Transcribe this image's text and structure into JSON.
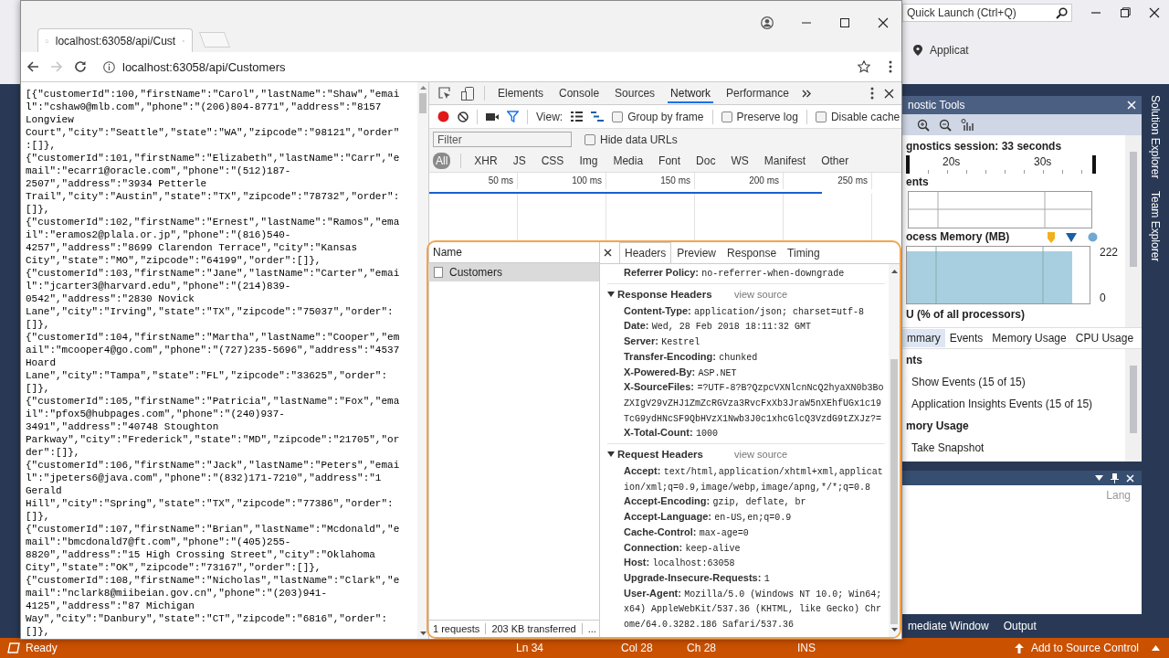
{
  "chrome": {
    "tab": {
      "title": "localhost:63058/api/Cust"
    },
    "forward_disabled": true,
    "address": "localhost:63058/api/Customers"
  },
  "json_view": {
    "records": [
      "[{\"customerId\":100,\"firstName\":\"Carol\",\"lastName\":\"Shaw\",\"email\":\"cshaw0@mlb.com\",\"phone\":\"(206)804-8771\",\"address\":\"8157 Longview Court\",\"city\":\"Seattle\",\"state\":\"WA\",\"zipcode\":\"98121\",\"order\":[]},",
      "{\"customerId\":101,\"firstName\":\"Elizabeth\",\"lastName\":\"Carr\",\"email\":\"ecarr1@oracle.com\",\"phone\":\"(512)187-2507\",\"address\":\"3934 Petterle Trail\",\"city\":\"Austin\",\"state\":\"TX\",\"zipcode\":\"78732\",\"order\":[]},",
      "{\"customerId\":102,\"firstName\":\"Ernest\",\"lastName\":\"Ramos\",\"email\":\"eramos2@plala.or.jp\",\"phone\":\"(816)540-4257\",\"address\":\"8699 Clarendon Terrace\",\"city\":\"Kansas City\",\"state\":\"MO\",\"zipcode\":\"64199\",\"order\":[]},",
      "{\"customerId\":103,\"firstName\":\"Jane\",\"lastName\":\"Carter\",\"email\":\"jcarter3@harvard.edu\",\"phone\":\"(214)839-0542\",\"address\":\"2830 Novick Lane\",\"city\":\"Irving\",\"state\":\"TX\",\"zipcode\":\"75037\",\"order\":[]},",
      "{\"customerId\":104,\"firstName\":\"Martha\",\"lastName\":\"Cooper\",\"email\":\"mcooper4@go.com\",\"phone\":\"(727)235-5696\",\"address\":\"4537 Hoard Lane\",\"city\":\"Tampa\",\"state\":\"FL\",\"zipcode\":\"33625\",\"order\":[]},",
      "{\"customerId\":105,\"firstName\":\"Patricia\",\"lastName\":\"Fox\",\"email\":\"pfox5@hubpages.com\",\"phone\":\"(240)937-3491\",\"address\":\"40748 Stoughton Parkway\",\"city\":\"Frederick\",\"state\":\"MD\",\"zipcode\":\"21705\",\"order\":[]},",
      "{\"customerId\":106,\"firstName\":\"Jack\",\"lastName\":\"Peters\",\"email\":\"jpeters6@java.com\",\"phone\":\"(832)171-7210\",\"address\":\"1 Gerald Hill\",\"city\":\"Spring\",\"state\":\"TX\",\"zipcode\":\"77386\",\"order\":[]},",
      "{\"customerId\":107,\"firstName\":\"Brian\",\"lastName\":\"Mcdonald\",\"email\":\"bmcdonald7@ft.com\",\"phone\":\"(405)255-8820\",\"address\":\"15 High Crossing Street\",\"city\":\"Oklahoma City\",\"state\":\"OK\",\"zipcode\":\"73167\",\"order\":[]},",
      "{\"customerId\":108,\"firstName\":\"Nicholas\",\"lastName\":\"Clark\",\"email\":\"nclark8@miibeian.gov.cn\",\"phone\":\"(203)941-4125\",\"address\":\"87 Michigan Way\",\"city\":\"Danbury\",\"state\":\"CT\",\"zipcode\":\"6816\",\"order\":[]},"
    ]
  },
  "devtools": {
    "tabs": [
      {
        "label": "Elements",
        "selected": false
      },
      {
        "label": "Console",
        "selected": false
      },
      {
        "label": "Sources",
        "selected": false
      },
      {
        "label": "Network",
        "selected": true
      },
      {
        "label": "Performance",
        "selected": false
      }
    ],
    "toolbar": {
      "view_label": "View:",
      "options": [
        {
          "label": "Group by frame",
          "checked": false
        },
        {
          "label": "Preserve log",
          "checked": false
        },
        {
          "label": "Disable cache",
          "checked": false
        }
      ]
    },
    "filter": {
      "placeholder": "Filter",
      "option": {
        "label": "Hide data URLs",
        "checked": false
      }
    },
    "types": [
      {
        "label": "All",
        "selected": true
      },
      {
        "label": "XHR",
        "selected": false
      },
      {
        "label": "JS",
        "selected": false
      },
      {
        "label": "CSS",
        "selected": false
      },
      {
        "label": "Img",
        "selected": false
      },
      {
        "label": "Media",
        "selected": false
      },
      {
        "label": "Font",
        "selected": false
      },
      {
        "label": "Doc",
        "selected": false
      },
      {
        "label": "WS",
        "selected": false
      },
      {
        "label": "Manifest",
        "selected": false
      },
      {
        "label": "Other",
        "selected": false
      }
    ],
    "overview_ticks": [
      "50 ms",
      "100 ms",
      "150 ms",
      "200 ms",
      "250 ms"
    ],
    "requests": {
      "column": "Name",
      "rows": [
        {
          "name": "Customers",
          "selected": true
        }
      ],
      "summary": [
        "1 requests",
        "203 KB transferred",
        "..."
      ]
    },
    "details": {
      "tabs": [
        {
          "label": "Headers",
          "selected": true
        },
        {
          "label": "Preview",
          "selected": false
        },
        {
          "label": "Response",
          "selected": false
        },
        {
          "label": "Timing",
          "selected": false
        }
      ],
      "general": [
        {
          "name": "Referrer Policy:",
          "value": "no-referrer-when-downgrade"
        }
      ],
      "sections": [
        {
          "title": "Response Headers",
          "link": "view source",
          "expanded": true,
          "headers": [
            {
              "name": "Content-Type:",
              "value": "application/json; charset=utf-8"
            },
            {
              "name": "Date:",
              "value": "Wed, 28 Feb 2018 18:11:32 GMT"
            },
            {
              "name": "Server:",
              "value": "Kestrel"
            },
            {
              "name": "Transfer-Encoding:",
              "value": "chunked"
            },
            {
              "name": "X-Powered-By:",
              "value": "ASP.NET"
            },
            {
              "name": "X-SourceFiles:",
              "value": "=?UTF-8?B?QzpcVXNlcnNcQ2hyaXN0b3BoZXIgV29vZHJ1ZmZcRGVza3RvcFxXb3JraW5nXEhfUGx1c19TcG9ydHNcSF9QbHVzX1Nwb3J0c1xhcGlcQ3VzdG9tZXJz?="
            },
            {
              "name": "X-Total-Count:",
              "value": "1000"
            }
          ]
        },
        {
          "title": "Request Headers",
          "link": "view source",
          "expanded": true,
          "headers": [
            {
              "name": "Accept:",
              "value": "text/html,application/xhtml+xml,application/xml;q=0.9,image/webp,image/apng,*/*;q=0.8"
            },
            {
              "name": "Accept-Encoding:",
              "value": "gzip, deflate, br"
            },
            {
              "name": "Accept-Language:",
              "value": "en-US,en;q=0.9"
            },
            {
              "name": "Cache-Control:",
              "value": "max-age=0"
            },
            {
              "name": "Connection:",
              "value": "keep-alive"
            },
            {
              "name": "Host:",
              "value": "localhost:63058"
            },
            {
              "name": "Upgrade-Insecure-Requests:",
              "value": "1"
            },
            {
              "name": "User-Agent:",
              "value": "Mozilla/5.0 (Windows NT 10.0; Win64; x64) AppleWebKit/537.36 (KHTML, like Gecko) Chrome/64.0.3282.186 Safari/537.36"
            }
          ]
        }
      ]
    }
  },
  "vs": {
    "quick_launch": {
      "placeholder": "Quick Launch (Ctrl+Q)"
    },
    "app_tab": "Applicat",
    "diagnostics": {
      "title": "nostic Tools",
      "session": "gnostics session: 33 seconds",
      "ruler": [
        "20s",
        "30s"
      ],
      "events_label": "ents",
      "memory_label": "ocess Memory (MB)",
      "memory_max": "222",
      "memory_min": "0",
      "cpu_label": "U (% of all processors)",
      "tabs": [
        {
          "label": "mmary",
          "selected": true
        },
        {
          "label": "Events",
          "selected": false
        },
        {
          "label": "Memory Usage",
          "selected": false
        },
        {
          "label": "CPU Usage",
          "selected": false
        }
      ],
      "list": [
        {
          "kind": "heading",
          "text": "nts"
        },
        {
          "kind": "item",
          "text": "Show Events (15 of 15)"
        },
        {
          "kind": "item",
          "text": "Application Insights Events (15 of 15)"
        },
        {
          "kind": "heading",
          "text": "mory Usage"
        },
        {
          "kind": "item",
          "text": "Take Snapshot"
        }
      ]
    },
    "lower_panel": {
      "column": "Lang"
    },
    "bottom_tabs": [
      {
        "label": "mediate Window",
        "selected": false
      },
      {
        "label": "Output",
        "selected": false
      }
    ],
    "side_tabs": [
      "Solution Explorer",
      "Team Explorer"
    ],
    "status": {
      "ready": "Ready",
      "line": "Ln 34",
      "col": "Col 28",
      "ch": "Ch 28",
      "mode": "INS",
      "source_control": "Add to Source Control"
    }
  }
}
